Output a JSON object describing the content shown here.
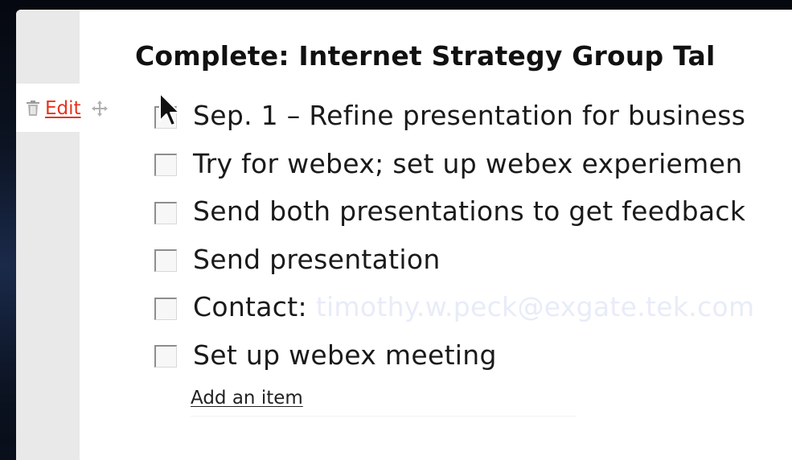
{
  "checklist": {
    "title": "Complete: Internet Strategy Group Tal",
    "row_tools": {
      "trash_icon": "trash-icon",
      "edit_label": "Edit",
      "move_icon": "move-icon"
    },
    "items": [
      {
        "text": "Sep. 1 – Refine presentation for business",
        "checked": false
      },
      {
        "text": "Try for webex; set up webex experiemen",
        "checked": false
      },
      {
        "text": "Send both presentations to get feedback",
        "checked": false
      },
      {
        "text": "Send presentation",
        "checked": false
      },
      {
        "text": "Contact: ",
        "link": "timothy.w.peck@exgate.tek.com",
        "checked": false
      },
      {
        "text": "Set up webex meeting",
        "checked": false
      }
    ],
    "add_item_label": "Add an item"
  },
  "colors": {
    "edit_link": "#e8321e",
    "gutter": "#e9e9e9",
    "email_link": "#e8ecf8"
  }
}
